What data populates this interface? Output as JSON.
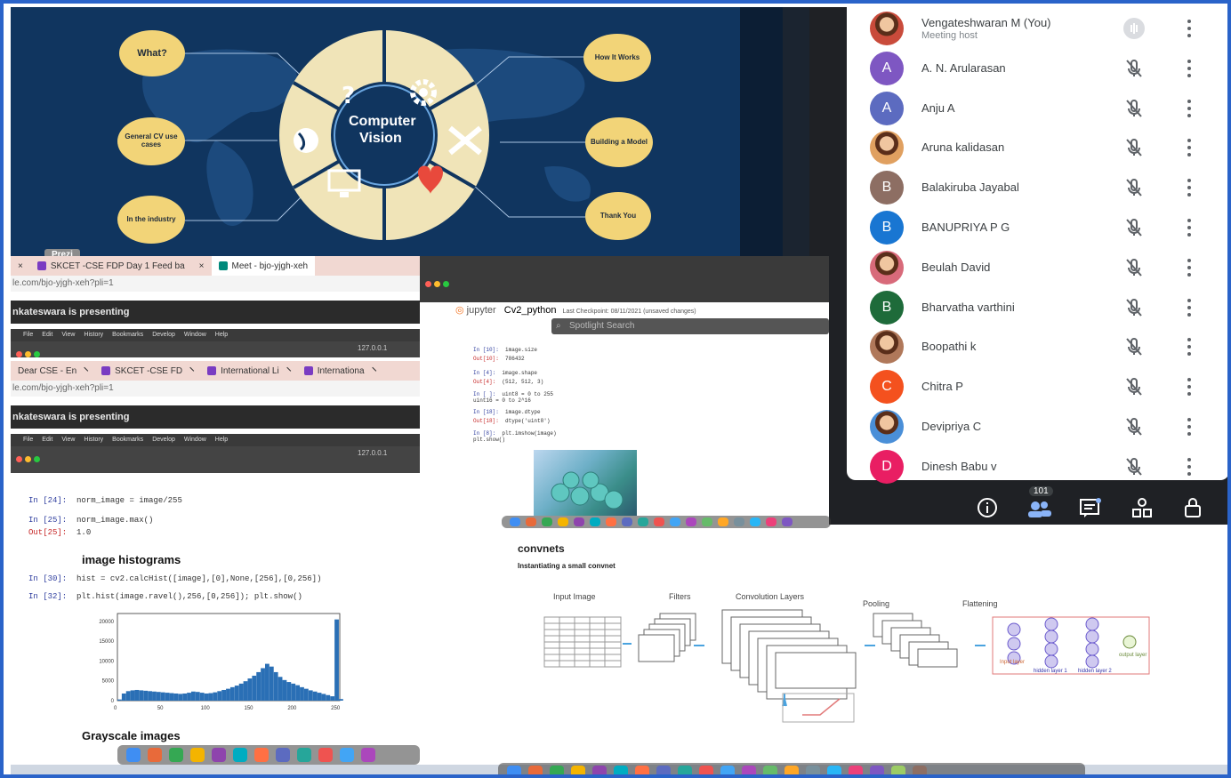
{
  "presentation": {
    "center_title": "Computer\nVision",
    "bubbles": [
      "What?",
      "How It Works",
      "General CV use cases",
      "Building a Model",
      "In the industry",
      "Thank You"
    ],
    "wheel_icons": [
      "question-icon",
      "gear-icon",
      "globe-icon",
      "tools-icon",
      "monitor-icon",
      "heart-icon"
    ],
    "tab_label": "Prezi"
  },
  "participants_panel": {
    "participants": [
      {
        "name": "Vengateshwaran M (You)",
        "subtitle": "Meeting host",
        "avatar_type": "photo",
        "avatar_letter": "",
        "avatar_color": "#c94b3b",
        "mic": "speaking"
      },
      {
        "name": "A. N. Arularasan",
        "subtitle": "",
        "avatar_type": "letter",
        "avatar_letter": "A",
        "avatar_color": "#7e57c2",
        "mic": "muted"
      },
      {
        "name": "Anju A",
        "subtitle": "",
        "avatar_type": "letter",
        "avatar_letter": "A",
        "avatar_color": "#5c6bc0",
        "mic": "muted"
      },
      {
        "name": "Aruna kalidasan",
        "subtitle": "",
        "avatar_type": "photo",
        "avatar_letter": "",
        "avatar_color": "#e0a060",
        "mic": "muted"
      },
      {
        "name": "Balakiruba Jayabal",
        "subtitle": "",
        "avatar_type": "letter",
        "avatar_letter": "B",
        "avatar_color": "#8d6e63",
        "mic": "muted"
      },
      {
        "name": "BANUPRIYA P G",
        "subtitle": "",
        "avatar_type": "letter",
        "avatar_letter": "B",
        "avatar_color": "#1976d2",
        "mic": "muted"
      },
      {
        "name": "Beulah David",
        "subtitle": "",
        "avatar_type": "photo",
        "avatar_letter": "",
        "avatar_color": "#d86a7a",
        "mic": "muted"
      },
      {
        "name": "Bharvatha varthini",
        "subtitle": "",
        "avatar_type": "letter",
        "avatar_letter": "B",
        "avatar_color": "#1e6b3a",
        "mic": "muted"
      },
      {
        "name": "Boopathi k",
        "subtitle": "",
        "avatar_type": "photo",
        "avatar_letter": "",
        "avatar_color": "#b0785a",
        "mic": "muted"
      },
      {
        "name": "Chitra P",
        "subtitle": "",
        "avatar_type": "letter",
        "avatar_letter": "C",
        "avatar_color": "#f4511e",
        "mic": "muted"
      },
      {
        "name": "Devipriya C",
        "subtitle": "",
        "avatar_type": "photo",
        "avatar_letter": "",
        "avatar_color": "#4a8fd8",
        "mic": "muted"
      },
      {
        "name": "Dinesh Babu v",
        "subtitle": "",
        "avatar_type": "letter",
        "avatar_letter": "D",
        "avatar_color": "#e91e63",
        "mic": "muted"
      }
    ],
    "toolbar": {
      "people_count": "101",
      "icons": [
        "info-icon",
        "people-icon",
        "chat-icon",
        "activities-icon",
        "host-controls-icon"
      ]
    }
  },
  "browser_left": {
    "tabs_top": [
      {
        "label": "×"
      },
      {
        "label": "SKCET -CSE FDP Day 1 Feed ba"
      },
      {
        "label": "×"
      },
      {
        "label": "Meet - bjo-yjgh-xeh"
      }
    ],
    "url": "le.com/bjo-yjgh-xeh?pli=1",
    "presenting": "nkateswara is presenting",
    "mac_menu": [
      "File",
      "Edit",
      "View",
      "History",
      "Bookmarks",
      "Develop",
      "Window",
      "Help"
    ],
    "address": "127.0.0.1",
    "tabs_second": [
      {
        "label": "Dear CSE - En"
      },
      {
        "label": "SKCET -CSE FD"
      },
      {
        "label": "International Li"
      },
      {
        "label": "Internationa"
      }
    ],
    "url2": "le.com/bjo-yjgh-xeh?pli=1",
    "presenting2": "nkateswara is presenting",
    "address2": "127.0.0.1",
    "cells": [
      {
        "prompt": "In [24]:",
        "code": "norm_image = image/255"
      },
      {
        "prompt": "In [25]:",
        "code": "norm_image.max()"
      },
      {
        "prompt": "Out[25]:",
        "code": "1.0"
      }
    ],
    "heading1": "image histograms",
    "cells2": [
      {
        "prompt": "In [30]:",
        "code": "hist = cv2.calcHist([image],[0],None,[256],[0,256])"
      },
      {
        "prompt": "In [32]:",
        "code": "plt.hist(image.ravel(),256,[0,256]); plt.show()"
      }
    ],
    "heading2": "Grayscale images"
  },
  "jupyter": {
    "brand": "jupyter",
    "notebook_name": "Cv2_python",
    "checkpoint": "Last Checkpoint: 08/11/2021 (unsaved changes)",
    "spotlight_placeholder": "Spotlight Search",
    "cells": [
      {
        "prompt": "In [10]:",
        "code": "image.size"
      },
      {
        "prompt": "Out[10]:",
        "code": "786432"
      },
      {
        "prompt": "In [4]:",
        "code": "image.shape"
      },
      {
        "prompt": "Out[4]:",
        "code": "(512, 512, 3)"
      },
      {
        "prompt": "In [ ]:",
        "code": "uint8 = 0 to 255\nuint16 = 0 to 2^16"
      },
      {
        "prompt": "In [18]:",
        "code": "image.dtype"
      },
      {
        "prompt": "Out[18]:",
        "code": "dtype('uint8')"
      },
      {
        "prompt": "In [8]:",
        "code": "plt.imshow(image)\nplt.show()"
      }
    ]
  },
  "chart_data": {
    "type": "bar",
    "title": "",
    "xlabel": "",
    "ylabel": "",
    "x_ticks": [
      "0",
      "50",
      "100",
      "150",
      "200",
      "250"
    ],
    "y_ticks": [
      "0",
      "5000",
      "10000",
      "15000",
      "20000"
    ],
    "xlim": [
      0,
      256
    ],
    "ylim": [
      0,
      22000
    ],
    "color": "#2a6fb5",
    "series": [
      {
        "x": [
          0,
          5,
          10,
          15,
          20,
          25,
          30,
          35,
          40,
          45,
          50,
          55,
          60,
          65,
          70,
          75,
          80,
          85,
          90,
          95,
          100,
          105,
          110,
          115,
          120,
          125,
          130,
          135,
          140,
          145,
          150,
          155,
          160,
          165,
          170,
          175,
          180,
          185,
          190,
          195,
          200,
          205,
          210,
          215,
          220,
          225,
          230,
          235,
          240,
          245,
          250,
          255
        ],
        "values": [
          300,
          1800,
          2400,
          2600,
          2700,
          2600,
          2500,
          2400,
          2300,
          2200,
          2100,
          2000,
          1900,
          1800,
          1700,
          1800,
          2000,
          2300,
          2200,
          2000,
          1800,
          1900,
          2100,
          2400,
          2700,
          3000,
          3400,
          3800,
          4300,
          4900,
          5600,
          6300,
          7200,
          8200,
          9300,
          8600,
          7200,
          6000,
          5200,
          4700,
          4300,
          3900,
          3400,
          3000,
          2600,
          2300,
          2000,
          1700,
          1400,
          1100,
          20500,
          400
        ]
      }
    ]
  },
  "slide2": {
    "title": "convnets",
    "subtitle": "Instantiating a small convnet",
    "labels": [
      "Input Image",
      "Filters",
      "Convolution Layers",
      "Pooling",
      "Flattening"
    ],
    "nn_labels": [
      "Input layer",
      "hidden layer 1",
      "hidden layer 2",
      "output layer"
    ]
  },
  "colors": {
    "frame_border": "#2a63c9",
    "slide_bg": "#10355f",
    "bubble": "#f2d478",
    "panel_bg": "#1f2125"
  }
}
